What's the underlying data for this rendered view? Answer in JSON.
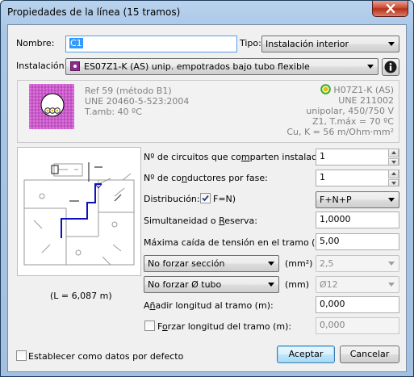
{
  "window": {
    "title": "Propiedades de la línea (15 tramos)"
  },
  "nombre": {
    "label": "Nombre:",
    "value": "C1"
  },
  "tipo": {
    "label": "Tipo:",
    "value": "Instalación interior"
  },
  "instalacion": {
    "label": "Instalación:",
    "value": "ES07Z1-K (AS) unip. empotrados bajo tubo flexible"
  },
  "info": {
    "ref": "Ref 59 (método B1)",
    "une_left": "UNE 20460-5-523:2004",
    "tamb": "T.amb: 40 ºC",
    "cable": "H07Z1-K (AS)",
    "une_right": "UNE 211002",
    "tension": "unipolar, 450/750 V",
    "tmax": "Z1, T.máx = 70 ºC",
    "conductor": "Cu, K = 56 m/Ohm·mm²"
  },
  "plan": {
    "length_label": "(L = 6,087 m)"
  },
  "form": {
    "circuitos_label": "Nº de circuitos que comparten instalación:",
    "circuitos_value": "1",
    "conductores_label": "Nº de conductores por fase:",
    "conductores_value": "1",
    "distribucion_label_pre": "Distribución: (",
    "distribucion_chk_label": "F=N)",
    "distribucion_value": "F+N+P",
    "simultaneidad_label": "Simultaneidad o Reserva:",
    "simultaneidad_value": "1,0000",
    "caida_label": "Máxima caída de tensión en el tramo (%):",
    "caida_value": "5,00",
    "seccion_combo": "No forzar sección",
    "seccion_unit": "(mm²)",
    "seccion_value": "2,5",
    "tubo_combo": "No forzar Ø tubo",
    "tubo_unit": "(mm)",
    "tubo_value": "Ø12",
    "anadir_label": "Añadir longitud al tramo (m):",
    "anadir_value": "0,000",
    "forzar_label": "Forzar longitud del tramo (m):",
    "forzar_value": "0,000"
  },
  "footer": {
    "defecto_label": "Establecer como datos por defecto",
    "aceptar": "Aceptar",
    "cancelar": "Cancelar"
  },
  "colors": {
    "accent_blue": "#3399ff",
    "cable_magenta": "#c040c0",
    "plan_blue": "#1010c0"
  },
  "icons": [
    "close-icon",
    "info-icon",
    "cable-section-icon",
    "status-circle-icon"
  ]
}
